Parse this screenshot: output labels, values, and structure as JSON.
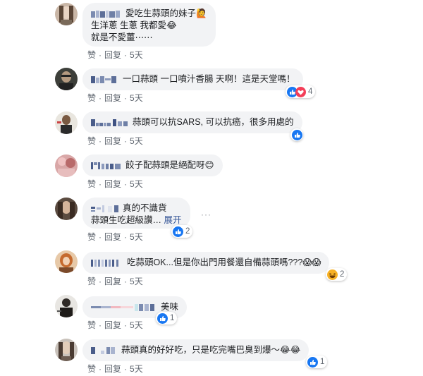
{
  "comments": [
    {
      "lines": [
        "愛吃生蒜頭的妹子🙋",
        "生洋蔥 生蔥 我都愛😂",
        "就是不愛薑⋯⋯"
      ],
      "like": "赞",
      "reply": "回复",
      "time": "5天",
      "reactions": null
    },
    {
      "lines": [
        "一口蒜頭 一口噴汁香腸 天啊！這是天堂嗎！"
      ],
      "like": "赞",
      "reply": "回复",
      "time": "5天",
      "reactions": {
        "icons": [
          "like-icon",
          "love-icon"
        ],
        "count": "4"
      }
    },
    {
      "lines": [
        "蒜頭可以抗SARS, 可以抗癌，很多用處的"
      ],
      "like": "赞",
      "reply": "回复",
      "time": "5天",
      "reactions": {
        "icons": [
          "like-icon"
        ],
        "count": ""
      }
    },
    {
      "lines": [
        "餃子配蒜頭是絕配呀😊"
      ],
      "like": "赞",
      "reply": "回复",
      "time": "5天",
      "reactions": null
    },
    {
      "lines": [
        "真的不識貨",
        "蒜頭生吃超級讚…"
      ],
      "see_more": "展开",
      "like": "赞",
      "reply": "回复",
      "time": "5天",
      "reactions": {
        "icons": [
          "like-icon"
        ],
        "count": "2"
      }
    },
    {
      "lines": [
        "吃蒜頭OK...但是你出門用餐還自備蒜頭嗎???😱😱"
      ],
      "like": "赞",
      "reply": "回复",
      "time": "5天",
      "reactions": {
        "icons": [
          "haha-icon"
        ],
        "count": "2"
      }
    },
    {
      "lines": [
        "美味"
      ],
      "like": "赞",
      "reply": "回复",
      "time": "5天",
      "reactions": {
        "icons": [
          "like-icon"
        ],
        "count": "1"
      }
    },
    {
      "lines": [
        "蒜頭真的好好吃，只是吃完嘴巴臭到爆～😂😂"
      ],
      "like": "赞",
      "reply": "回复",
      "time": "5天",
      "reactions": {
        "icons": [
          "like-icon"
        ],
        "count": "1"
      }
    }
  ],
  "more_options": "···",
  "colors": {
    "bubble": "#f2f3f5",
    "link": "#385898",
    "meta": "#606770",
    "like": "#1877f2",
    "love": "#f33e58",
    "haha": "#f7b125"
  }
}
